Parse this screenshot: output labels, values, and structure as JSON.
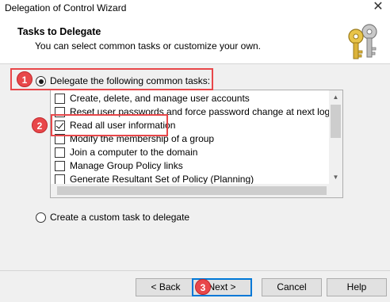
{
  "window": {
    "title": "Delegation of Control Wizard",
    "close_glyph": "✕"
  },
  "header": {
    "title": "Tasks to Delegate",
    "subtitle": "You can select common tasks or customize your own.",
    "icon": "keys-icon"
  },
  "options": {
    "common": {
      "label": "Delegate the following common tasks:",
      "selected": true
    },
    "custom": {
      "label": "Create a custom task to delegate",
      "selected": false
    }
  },
  "tasks": [
    {
      "label": "Create, delete, and manage user accounts",
      "checked": false
    },
    {
      "label": "Reset user passwords and force password change at next logon",
      "checked": false
    },
    {
      "label": "Read all user information",
      "checked": true
    },
    {
      "label": "Modify the membership of a group",
      "checked": false
    },
    {
      "label": "Join a computer to the domain",
      "checked": false
    },
    {
      "label": "Manage Group Policy links",
      "checked": false
    },
    {
      "label": "Generate Resultant Set of Policy (Planning)",
      "checked": false
    }
  ],
  "callouts": {
    "step1": "1",
    "step2": "2",
    "step3": "3"
  },
  "buttons": {
    "back": "< Back",
    "next": "Next >",
    "cancel": "Cancel",
    "help": "Help"
  },
  "scroll": {
    "up_glyph": "▲",
    "down_glyph": "▼"
  },
  "colors": {
    "callout": "#e8474a",
    "focus": "#0078d7"
  }
}
